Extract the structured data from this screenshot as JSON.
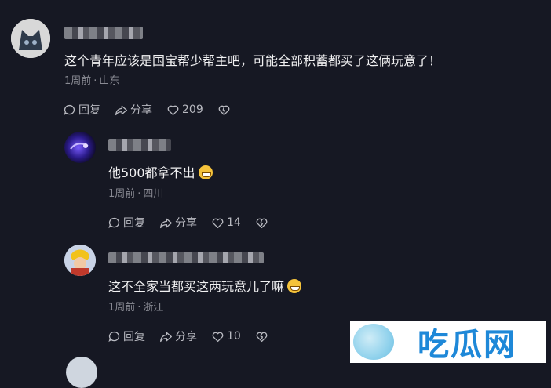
{
  "comments": [
    {
      "text": "这个青年应该是国宝帮少帮主吧，可能全部积蓄都买了这俩玩意了！",
      "time": "1周前",
      "location": "山东",
      "reply_label": "回复",
      "share_label": "分享",
      "likes": "209"
    },
    {
      "text": "他500都拿不出",
      "time": "1周前",
      "location": "四川",
      "reply_label": "回复",
      "share_label": "分享",
      "likes": "14"
    },
    {
      "text": "这不全家当都买这两玩意儿了嘛",
      "time": "1周前",
      "location": "浙江",
      "reply_label": "回复",
      "share_label": "分享",
      "likes": "10"
    }
  ],
  "separator": "·",
  "watermark": {
    "text": "吃瓜网"
  },
  "colors": {
    "background": "#161823",
    "meta": "#8a8b94",
    "watermark_text": "#1e88d8"
  },
  "icons": [
    "comment-icon",
    "share-icon",
    "heart-icon",
    "dislike-icon",
    "emoji-icon"
  ]
}
